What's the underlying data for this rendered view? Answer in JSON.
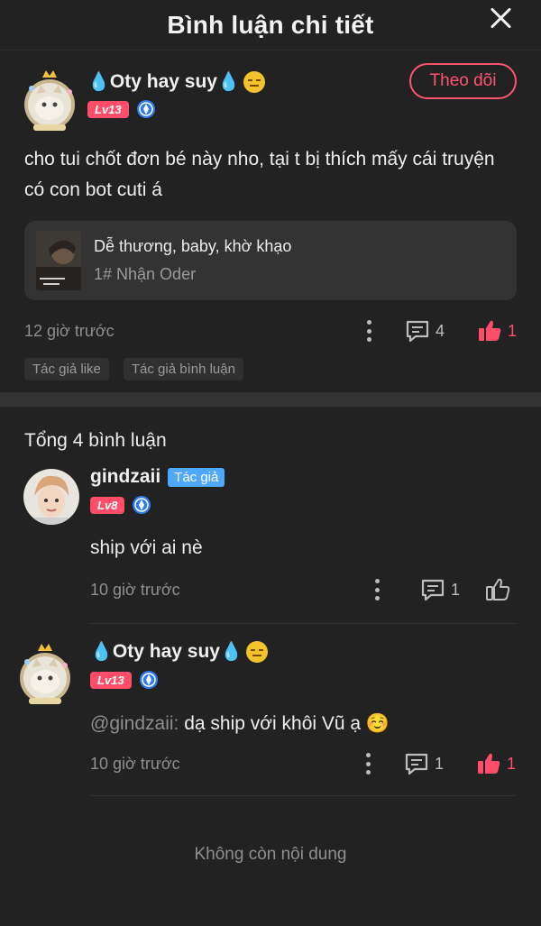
{
  "header": {
    "title": "Bình luận chi tiết"
  },
  "post": {
    "author": {
      "name": "Oty hay suy",
      "level": "Lv13"
    },
    "follow_label": "Theo dõi",
    "text": "cho tui chốt đơn bé này nho, tại t bị thích mấy cái truyện có con bot cuti á",
    "book": {
      "title": "Dễ thương, baby, khờ khạo",
      "subtitle": "1# Nhận Oder"
    },
    "time": "12 giờ trước",
    "comment_count": "4",
    "like_count": "1",
    "tags": [
      "Tác giả like",
      "Tác giả bình luận"
    ]
  },
  "comments_section": {
    "total_label": "Tổng 4 bình luận",
    "items": [
      {
        "name": "gindzaii",
        "author_tag": "Tác giả",
        "level": "Lv8",
        "text": "ship với ai nè",
        "time": "10 giờ trước",
        "reply_count": "1"
      },
      {
        "name": "Oty hay suy",
        "level": "Lv13",
        "mention": "@gindzaii:",
        "text": " dạ ship với khôi Vũ ạ ☺️",
        "time": "10 giờ trước",
        "reply_count": "1",
        "like_count": "1"
      }
    ],
    "end_label": "Không còn nội dung"
  },
  "colors": {
    "accent": "#ff4d6a",
    "author_tag": "#4fa8ff",
    "background": "#222222"
  }
}
